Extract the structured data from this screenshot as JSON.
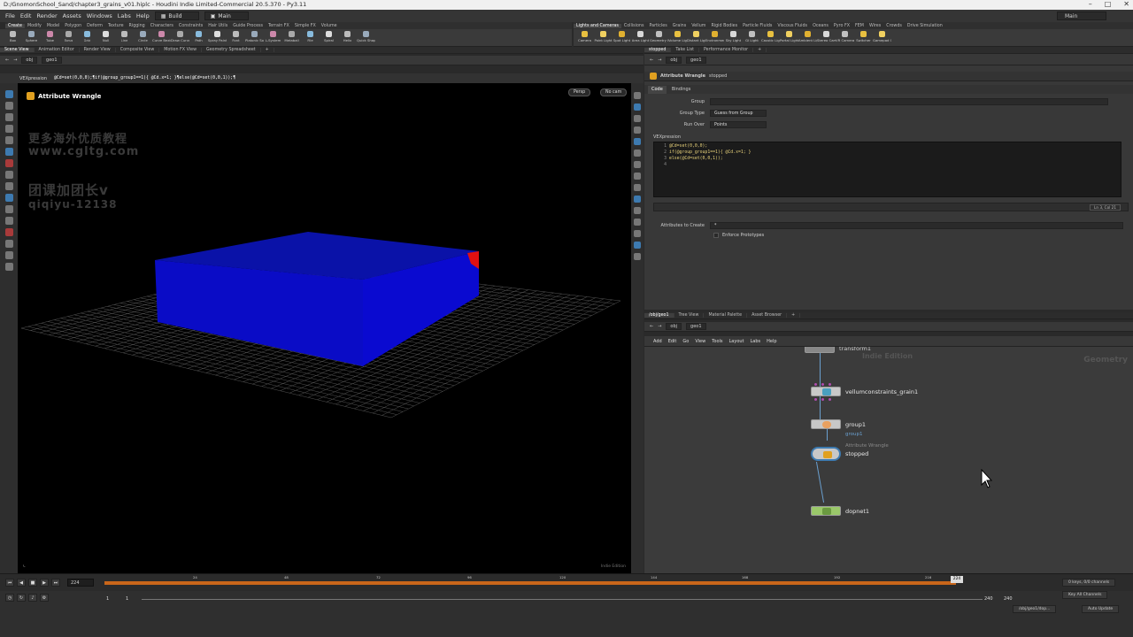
{
  "window": {
    "title": "D:/GnomonSchool_Sand/chapter3_grains_v01.hiplc - Houdini Indie Limited-Commercial 20.5.370 - Py3.11"
  },
  "menu": {
    "items": [
      "File",
      "Edit",
      "Render",
      "Assets",
      "Windows",
      "Labs",
      "Help"
    ],
    "build": "Build",
    "main": "Main",
    "right_main": "Main"
  },
  "shelf_left": {
    "tabs": [
      "Create",
      "Modify",
      "Model",
      "Polygon",
      "Deform",
      "Texture",
      "Rigging",
      "Characters",
      "Constraints",
      "Hair Utils",
      "Guide Process",
      "Terrain FX",
      "Simple FX",
      "Volume"
    ],
    "tools": [
      "Box",
      "Sphere",
      "Tube",
      "Torus",
      "Grid",
      "Null",
      "Line",
      "Circle",
      "Curve Bezier",
      "Draw Curve",
      "Path",
      "Spray Paint",
      "Font",
      "Platonic Solids",
      "L-System",
      "Metaball",
      "File",
      "Spiral",
      "Helix",
      "Quick Shapes"
    ]
  },
  "shelf_right": {
    "tabs": [
      "Lights and Cameras",
      "Collisions",
      "Particles",
      "Grains",
      "Vellum",
      "Rigid Bodies",
      "Particle Fluids",
      "Viscous Fluids",
      "Oceans",
      "Pyro FX",
      "FEM",
      "Wires",
      "Crowds",
      "Drive Simulation"
    ],
    "tools": [
      "Camera",
      "Point Light",
      "Spot Light",
      "Area Light",
      "Geometry Light",
      "Volume Light",
      "Distant Light",
      "Environment Light",
      "Sky Light",
      "GI Light",
      "Caustic Light",
      "Portal Light",
      "Ambient Light",
      "Stereo Camera",
      "VR Camera",
      "Switcher",
      "Gamepad Camera"
    ]
  },
  "left_pane": {
    "tabs": [
      "Scene View",
      "Animation Editor",
      "Render View",
      "Composite View",
      "Motion FX View",
      "Geometry Spreadsheet"
    ],
    "path": [
      "obj",
      "geo1"
    ],
    "vex_label": "VEXpression",
    "vex_code": "@Cd=set(0,0,0);¶if(@group_group1==1){ @Cd.x=1; }¶else(@Cd=set(0,0,1));¶"
  },
  "viewport": {
    "title": "Attribute Wrangle",
    "persp": "Persp",
    "cam": "No cam",
    "watermark1": "更多海外优质教程",
    "watermark2": "www.cgltg.com",
    "watermark3": "团课加团长v",
    "watermark4": "qiqiyu-12138",
    "edition": "Indie Edition"
  },
  "right_pane": {
    "tabs": [
      "stopped",
      "Take List",
      "Performance Monitor"
    ],
    "path": [
      "obj",
      "geo1"
    ],
    "node_type": "Attribute Wrangle",
    "node_name": "stopped",
    "param_tabs": [
      "Code",
      "Bindings"
    ],
    "group_label": "Group",
    "group_value": "",
    "group_type_label": "Group Type",
    "group_type_value": "Guess from Group",
    "run_over_label": "Run Over",
    "run_over_value": "Points",
    "vexpression_label": "VEXpression",
    "code_lines": [
      "@Cd=set(0,0,0);",
      "if(@group_group1==1){ @Cd.x=1; }",
      "else(@Cd=set(0,0,1));",
      ""
    ],
    "line_numbers": [
      "1",
      "2",
      "3",
      "4"
    ],
    "status": "Ln 3, Col 21",
    "attrs_label": "Attributes to Create",
    "attrs_value": "*",
    "enforce_label": "Enforce Prototypes"
  },
  "network": {
    "tabs": [
      "/obj/geo1",
      "Tree View",
      "Material Palette",
      "Asset Browser"
    ],
    "path": [
      "obj",
      "geo1"
    ],
    "menu": [
      "Add",
      "Edit",
      "Go",
      "View",
      "Tools",
      "Layout",
      "Labs",
      "Help"
    ],
    "bg_edition": "Indie Edition",
    "bg_context": "Geometry",
    "nodes": {
      "top": "transform1",
      "vellum": "vellumconstraints_grain1",
      "group": "group1",
      "group_sub": "group1",
      "wrangle_type": "Attribute Wrangle",
      "wrangle": "stopped",
      "dop": "dopnet1"
    }
  },
  "timeline": {
    "frame": "224",
    "ticks": [
      "24",
      "48",
      "72",
      "96",
      "120",
      "144",
      "168",
      "192",
      "216"
    ],
    "current": "224",
    "start": "1",
    "start2": "1",
    "end": "240",
    "end2": "240",
    "keys": "0 keys, 0/0 channels",
    "key_all": "Key All Channels",
    "path_btn": "/obj/geo1/dop...",
    "auto_update": "Auto Update"
  },
  "colors": {
    "accent": "#3d7ab0",
    "timeline": "#c9661a",
    "box_blue": "#0a0ad0",
    "box_red": "#e01010"
  }
}
